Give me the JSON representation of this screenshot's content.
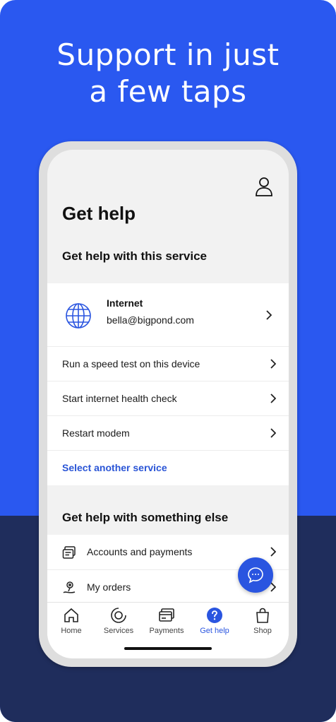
{
  "promo": {
    "headline_line1": "Support in just",
    "headline_line2": "a few taps"
  },
  "icons": {
    "profile": "profile-icon",
    "service": "globe-icon",
    "chevron": "chevron-right-icon",
    "accounts": "receipt-icon",
    "orders": "pin-icon",
    "chat": "chat-bubble-icon"
  },
  "colors": {
    "background": "#2a58f0",
    "band": "#1f2d5c",
    "accent": "#2a55e0",
    "link": "#2a55d6"
  },
  "header": {
    "title": "Get help"
  },
  "service_section": {
    "title": "Get help with this service",
    "service": {
      "name": "Internet",
      "account": "bella@bigpond.com"
    },
    "actions": [
      {
        "label": "Run a speed test on this device"
      },
      {
        "label": "Start internet health check"
      },
      {
        "label": "Restart modem"
      }
    ],
    "select_link": "Select another service"
  },
  "other_section": {
    "title": "Get help with something else",
    "items": [
      {
        "label": "Accounts and payments",
        "icon": "receipt-icon"
      },
      {
        "label": "My orders",
        "icon": "pin-icon"
      }
    ]
  },
  "tabbar": {
    "active": "Get help",
    "tabs": [
      {
        "label": "Home",
        "icon": "home-icon"
      },
      {
        "label": "Services",
        "icon": "services-ring-icon"
      },
      {
        "label": "Payments",
        "icon": "card-icon"
      },
      {
        "label": "Get help",
        "icon": "help-circle-icon"
      },
      {
        "label": "Shop",
        "icon": "bag-icon"
      }
    ]
  }
}
